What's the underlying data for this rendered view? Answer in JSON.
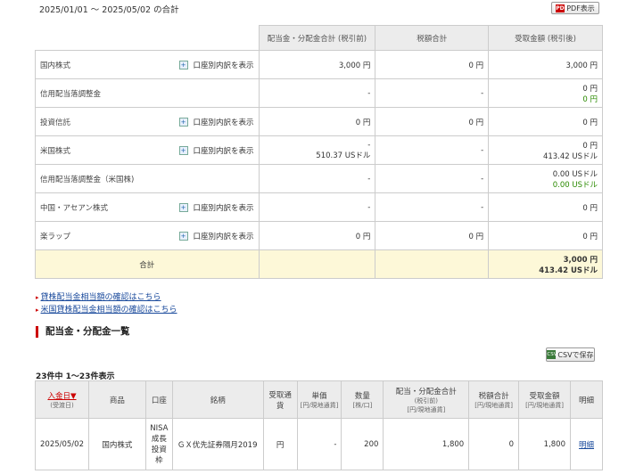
{
  "period": "2025/01/01 〜 2025/05/02 の合計",
  "pdf_label": "PDF表示",
  "pdf_icon_text": "PDF",
  "summary": {
    "headers": [
      "配当金・分配金合計 (税引前)",
      "税額合計",
      "受取金額 (税引後)"
    ],
    "breakdown_label": "口座別内訳を表示",
    "rows": [
      {
        "name": "国内株式",
        "a": "3,000 円",
        "a2": "",
        "b": "0 円",
        "c": "3,000 円",
        "c2": ""
      },
      {
        "name": "信用配当落調整金",
        "a": "-",
        "a2": "",
        "b": "-",
        "c": "0 円",
        "c2": "0 円"
      },
      {
        "name": "投資信託",
        "a": "0 円",
        "a2": "",
        "b": "0 円",
        "c": "0 円",
        "c2": ""
      },
      {
        "name": "米国株式",
        "a": "-",
        "a2": "510.37 USドル",
        "b": "-",
        "c": "0 円",
        "c2": "413.42 USドル"
      },
      {
        "name": "信用配当落調整金（米国株)",
        "a": "-",
        "a2": "",
        "b": "-",
        "c": "0.00 USドル",
        "c2": "0.00 USドル"
      },
      {
        "name": "中国・アセアン株式",
        "a": "-",
        "a2": "",
        "b": "-",
        "c": "0 円",
        "c2": ""
      },
      {
        "name": "楽ラップ",
        "a": "0 円",
        "a2": "",
        "b": "0 円",
        "c": "0 円",
        "c2": ""
      }
    ],
    "total_label": "合計",
    "total_line1": "3,000 円",
    "total_line2": "413.42 USドル"
  },
  "links": [
    "貸株配当金相当額の確認はこちら",
    "米国貸株配当金相当額の確認はこちら"
  ],
  "section_title": "配当金・分配金一覧",
  "csv_label": "CSVで保存",
  "csv_icon_text": "CSV",
  "count_text": "23件中 1〜23件表示",
  "list": {
    "headers": {
      "date": "入金日▼",
      "date_sub": "(受渡日)",
      "product": "商品",
      "account": "口座",
      "issue": "銘柄",
      "currency": "受取通貨",
      "unit": "単価",
      "unit_sub": "[円/現地通貨]",
      "qty": "数量",
      "qty_sub": "[株/口]",
      "gross": "配当・分配金合計",
      "gross_sub1": "(税引前)",
      "gross_sub2": "[円/現地通貨]",
      "tax": "税額合計",
      "tax_sub": "[円/現地通貨]",
      "net": "受取金額",
      "net_sub": "[円/現地通貨]",
      "detail": "明細"
    },
    "row": {
      "date": "2025/05/02",
      "product": "国内株式",
      "account": "NISA成長投資枠",
      "issue": "ＧＸ优先証券隔月2019",
      "currency": "円",
      "unit": "-",
      "qty": "200",
      "gross": "1,800",
      "tax": "0",
      "net": "1,800",
      "detail": "明細"
    }
  }
}
